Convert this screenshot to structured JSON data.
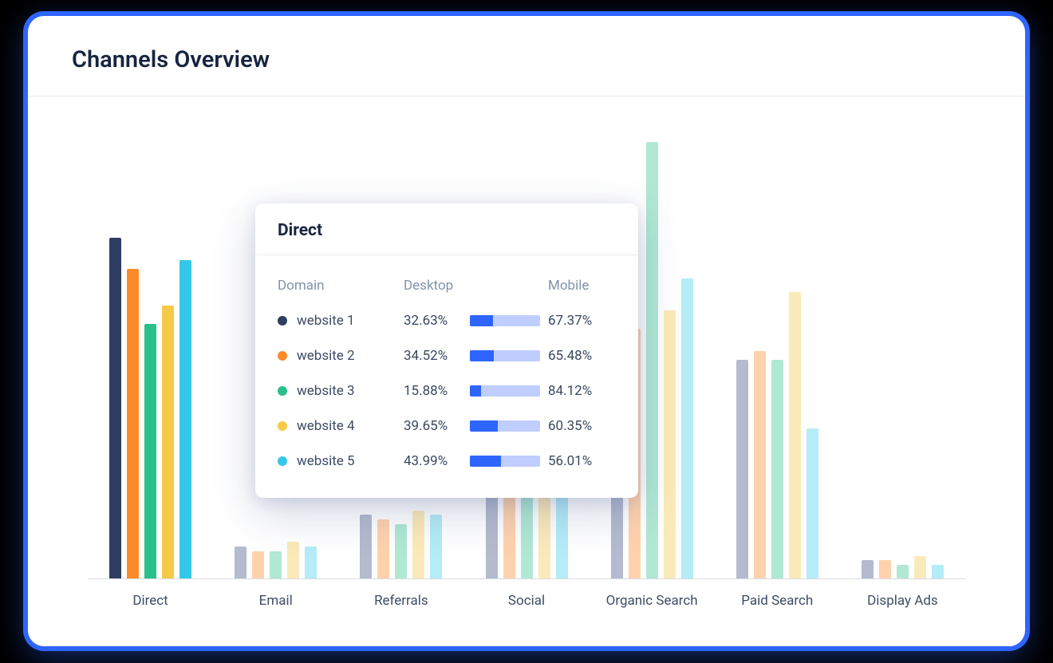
{
  "header": {
    "title": "Channels Overview"
  },
  "colors": {
    "series": [
      "#2e3e63",
      "#ff8a2a",
      "#2bbf8a",
      "#f7c948",
      "#35c7e8"
    ],
    "series_faded": [
      "#b4bbcf",
      "#ffd2ad",
      "#b0e8d4",
      "#fbeab9",
      "#b4ecf7"
    ],
    "bar_desktop": "#2f65ff",
    "bar_mobile": "#c0ceff"
  },
  "tooltip": {
    "title": "Direct",
    "columns": {
      "domain": "Domain",
      "desktop": "Desktop",
      "mobile": "Mobile"
    },
    "rows": [
      {
        "domain": "website 1",
        "desktop": "32.63%",
        "desktop_num": 32.63,
        "mobile": "67.37%"
      },
      {
        "domain": "website 2",
        "desktop": "34.52%",
        "desktop_num": 34.52,
        "mobile": "65.48%"
      },
      {
        "domain": "website 3",
        "desktop": "15.88%",
        "desktop_num": 15.88,
        "mobile": "84.12%"
      },
      {
        "domain": "website 4",
        "desktop": "39.65%",
        "desktop_num": 39.65,
        "mobile": "60.35%"
      },
      {
        "domain": "website 5",
        "desktop": "43.99%",
        "desktop_num": 43.99,
        "mobile": "56.01%"
      }
    ]
  },
  "chart_data": {
    "type": "bar",
    "title": "Channels Overview",
    "xlabel": "",
    "ylabel": "",
    "ylim": [
      0,
      100
    ],
    "categories": [
      "Direct",
      "Email",
      "Referrals",
      "Social",
      "Organic Search",
      "Paid Search",
      "Display Ads"
    ],
    "active_category": 0,
    "series": [
      {
        "name": "website 1",
        "color": "#2e3e63",
        "values": [
          75,
          7,
          14,
          25,
          70,
          48,
          4
        ]
      },
      {
        "name": "website 2",
        "color": "#ff8a2a",
        "values": [
          68,
          6,
          13,
          27,
          55,
          50,
          4
        ]
      },
      {
        "name": "website 3",
        "color": "#2bbf8a",
        "values": [
          56,
          6,
          12,
          28,
          96,
          48,
          3
        ]
      },
      {
        "name": "website 4",
        "color": "#f7c948",
        "values": [
          60,
          8,
          15,
          27,
          59,
          63,
          5
        ]
      },
      {
        "name": "website 5",
        "color": "#35c7e8",
        "values": [
          70,
          7,
          14,
          28,
          66,
          33,
          3
        ]
      }
    ]
  }
}
